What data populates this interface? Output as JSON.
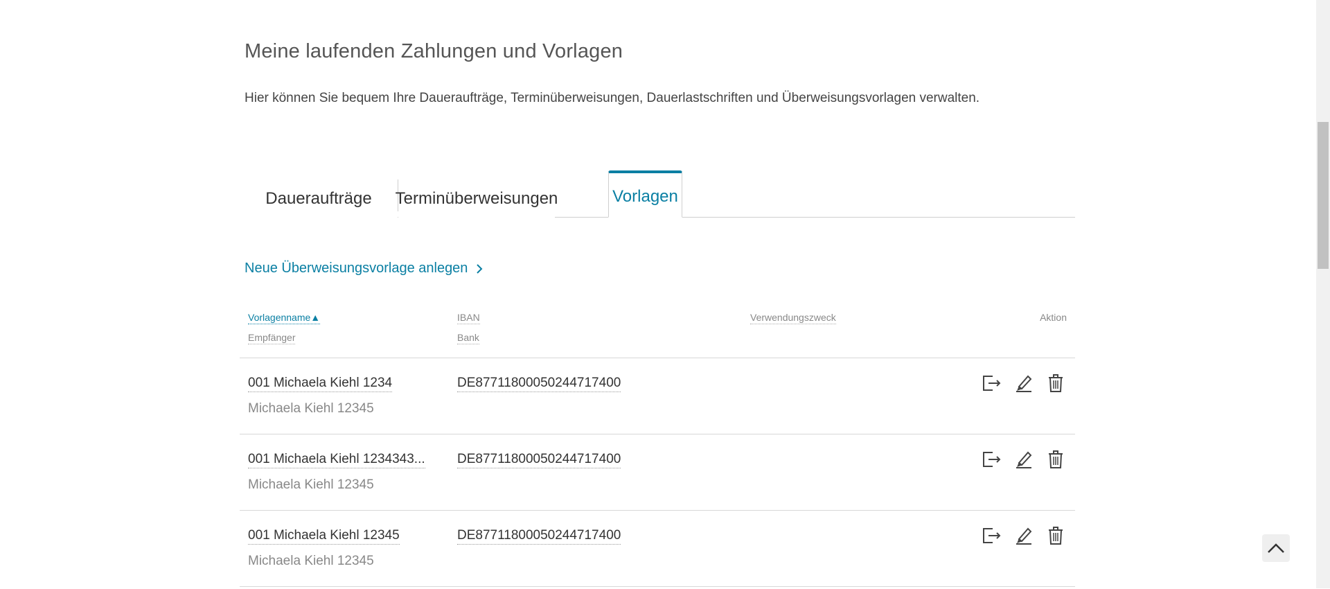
{
  "page": {
    "title": "Meine laufenden Zahlungen und Vorlagen",
    "intro": "Hier können Sie bequem Ihre Daueraufträge, Terminüberweisungen, Dauerlastschriften und Überweisungsvorlagen verwalten."
  },
  "tabs": [
    {
      "label": "Daueraufträge",
      "active": false
    },
    {
      "label": "Terminüberweisungen",
      "active": false
    },
    {
      "label": "Vorlagen",
      "active": true
    }
  ],
  "new_link": {
    "label": "Neue Überweisungsvorlage anlegen",
    "icon": "chevron-right-icon"
  },
  "table": {
    "headers": {
      "name": "Vorlagenname",
      "sort_indicator": "▲",
      "recipient": "Empfänger",
      "iban": "IBAN",
      "bank": "Bank",
      "purpose": "Verwendungszweck",
      "action": "Aktion"
    },
    "rows": [
      {
        "name": "001 Michaela Kiehl 1234",
        "recipient": "Michaela Kiehl 12345",
        "iban": "DE87711800050244717400"
      },
      {
        "name": "001 Michaela Kiehl 1234343...",
        "recipient": "Michaela Kiehl 12345",
        "iban": "DE87711800050244717400"
      },
      {
        "name": "001 Michaela Kiehl 12345",
        "recipient": "Michaela Kiehl 12345",
        "iban": "DE87711800050244717400"
      }
    ],
    "row_actions": [
      "execute-transfer-icon",
      "edit-icon",
      "delete-icon"
    ]
  },
  "colors": {
    "accent": "#0a7fa3",
    "text": "#333333",
    "muted": "#888888",
    "divider": "#d7d7d7"
  }
}
